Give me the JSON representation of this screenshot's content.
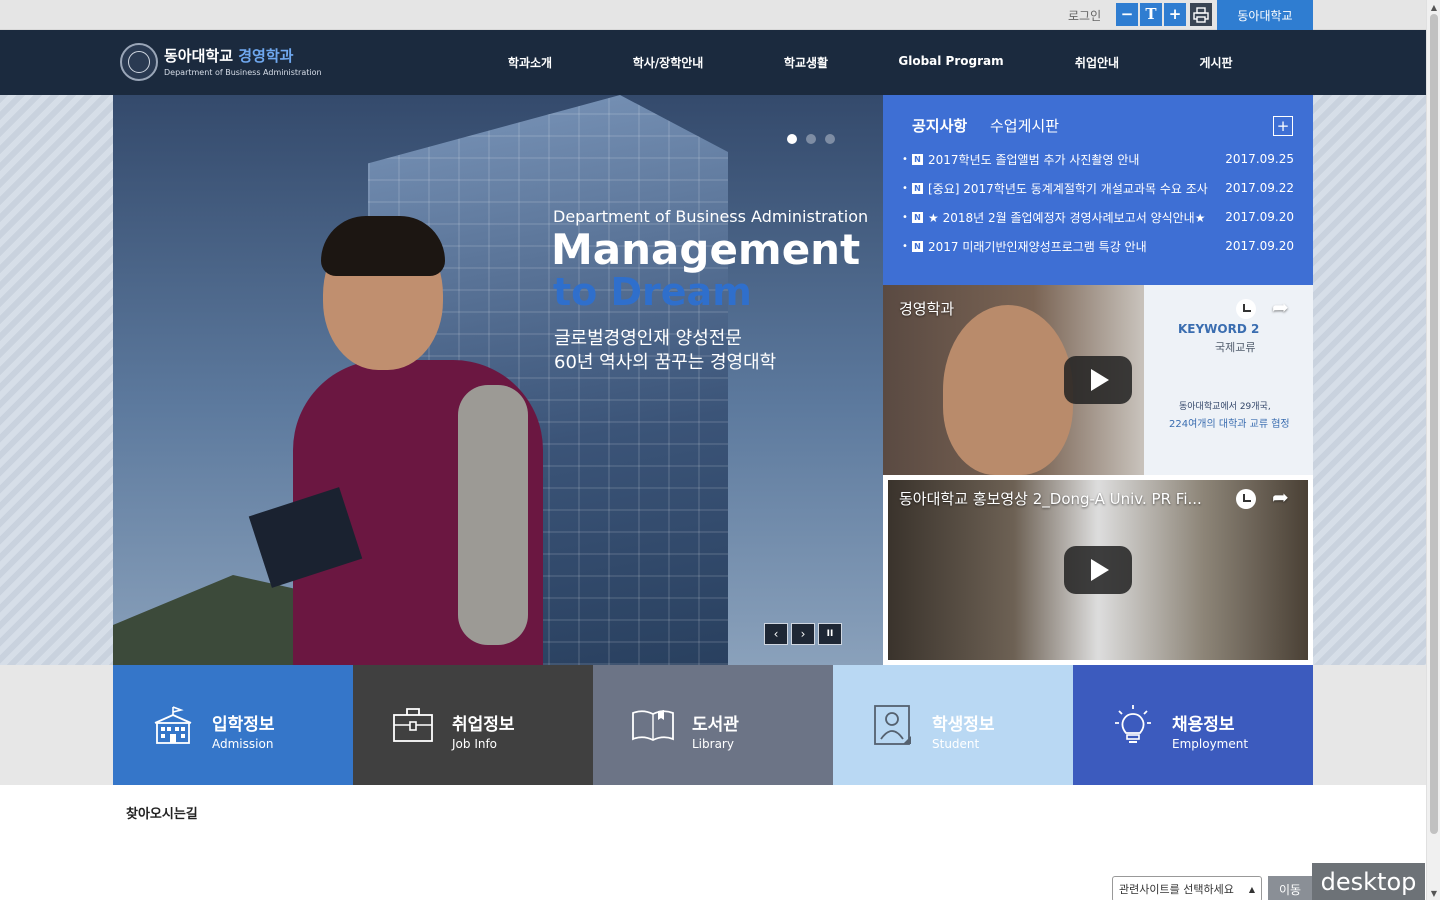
{
  "util": {
    "login": "로그인",
    "tools": [
      "−",
      "T",
      "+"
    ],
    "univ": "동아대학교"
  },
  "header": {
    "logo_title_main": "동아대학교",
    "logo_title_accent": "경영학과",
    "logo_sub": "Department of Business Administration",
    "nav": [
      "학과소개",
      "학사/장학안내",
      "학교생활",
      "Global Program",
      "취업안내",
      "게시판"
    ]
  },
  "hero": {
    "sub": "Department of Business Administration",
    "title": "Management",
    "title2": "to Dream",
    "kr1": "글로벌경영인재 양성전문",
    "kr2": "60년 역사의 꿈꾸는 경영대학",
    "controls": [
      "‹",
      "›",
      "II"
    ]
  },
  "notice": {
    "tabs": [
      "공지사항",
      "수업게시판"
    ],
    "plus": "+",
    "badge": "N",
    "items": [
      {
        "title": "2017학년도 졸업앨범 추가 사진촬영 안내",
        "date": "2017.09.25"
      },
      {
        "title": "[중요] 2017학년도 동계계절학기 개설교과목 수요 조사",
        "date": "2017.09.22"
      },
      {
        "title": "★ 2018년 2월 졸업예정자 경영사례보고서 양식안내★",
        "date": "2017.09.20"
      },
      {
        "title": "2017 미래기반인재양성프로그램 특강 안내",
        "date": "2017.09.20"
      }
    ]
  },
  "videos": [
    {
      "title": "경영학과",
      "keyword": "KEYWORD 2",
      "keyword_sub": "국제교류",
      "line1": "동아대학교에서 29개국,",
      "line2": "224여개의 대학과 교류 협정"
    },
    {
      "title": "동아대학교 홍보영상 2_Dong-A Univ. PR Fi..."
    }
  ],
  "quick": [
    {
      "kr": "입학정보",
      "en": "Admission",
      "color": "#3576c9"
    },
    {
      "kr": "취업정보",
      "en": "Job Info",
      "color": "#404040"
    },
    {
      "kr": "도서관",
      "en": "Library",
      "color": "#6c7486"
    },
    {
      "kr": "학생정보",
      "en": "Student",
      "color": "#b9d8f3"
    },
    {
      "kr": "채용정보",
      "en": "Employment",
      "color": "#3c5bbe"
    }
  ],
  "footer": {
    "directions": "찾아오시는길",
    "select_placeholder": "관련사이트를 선택하세요",
    "go": "이동",
    "desktop": "desktop"
  }
}
